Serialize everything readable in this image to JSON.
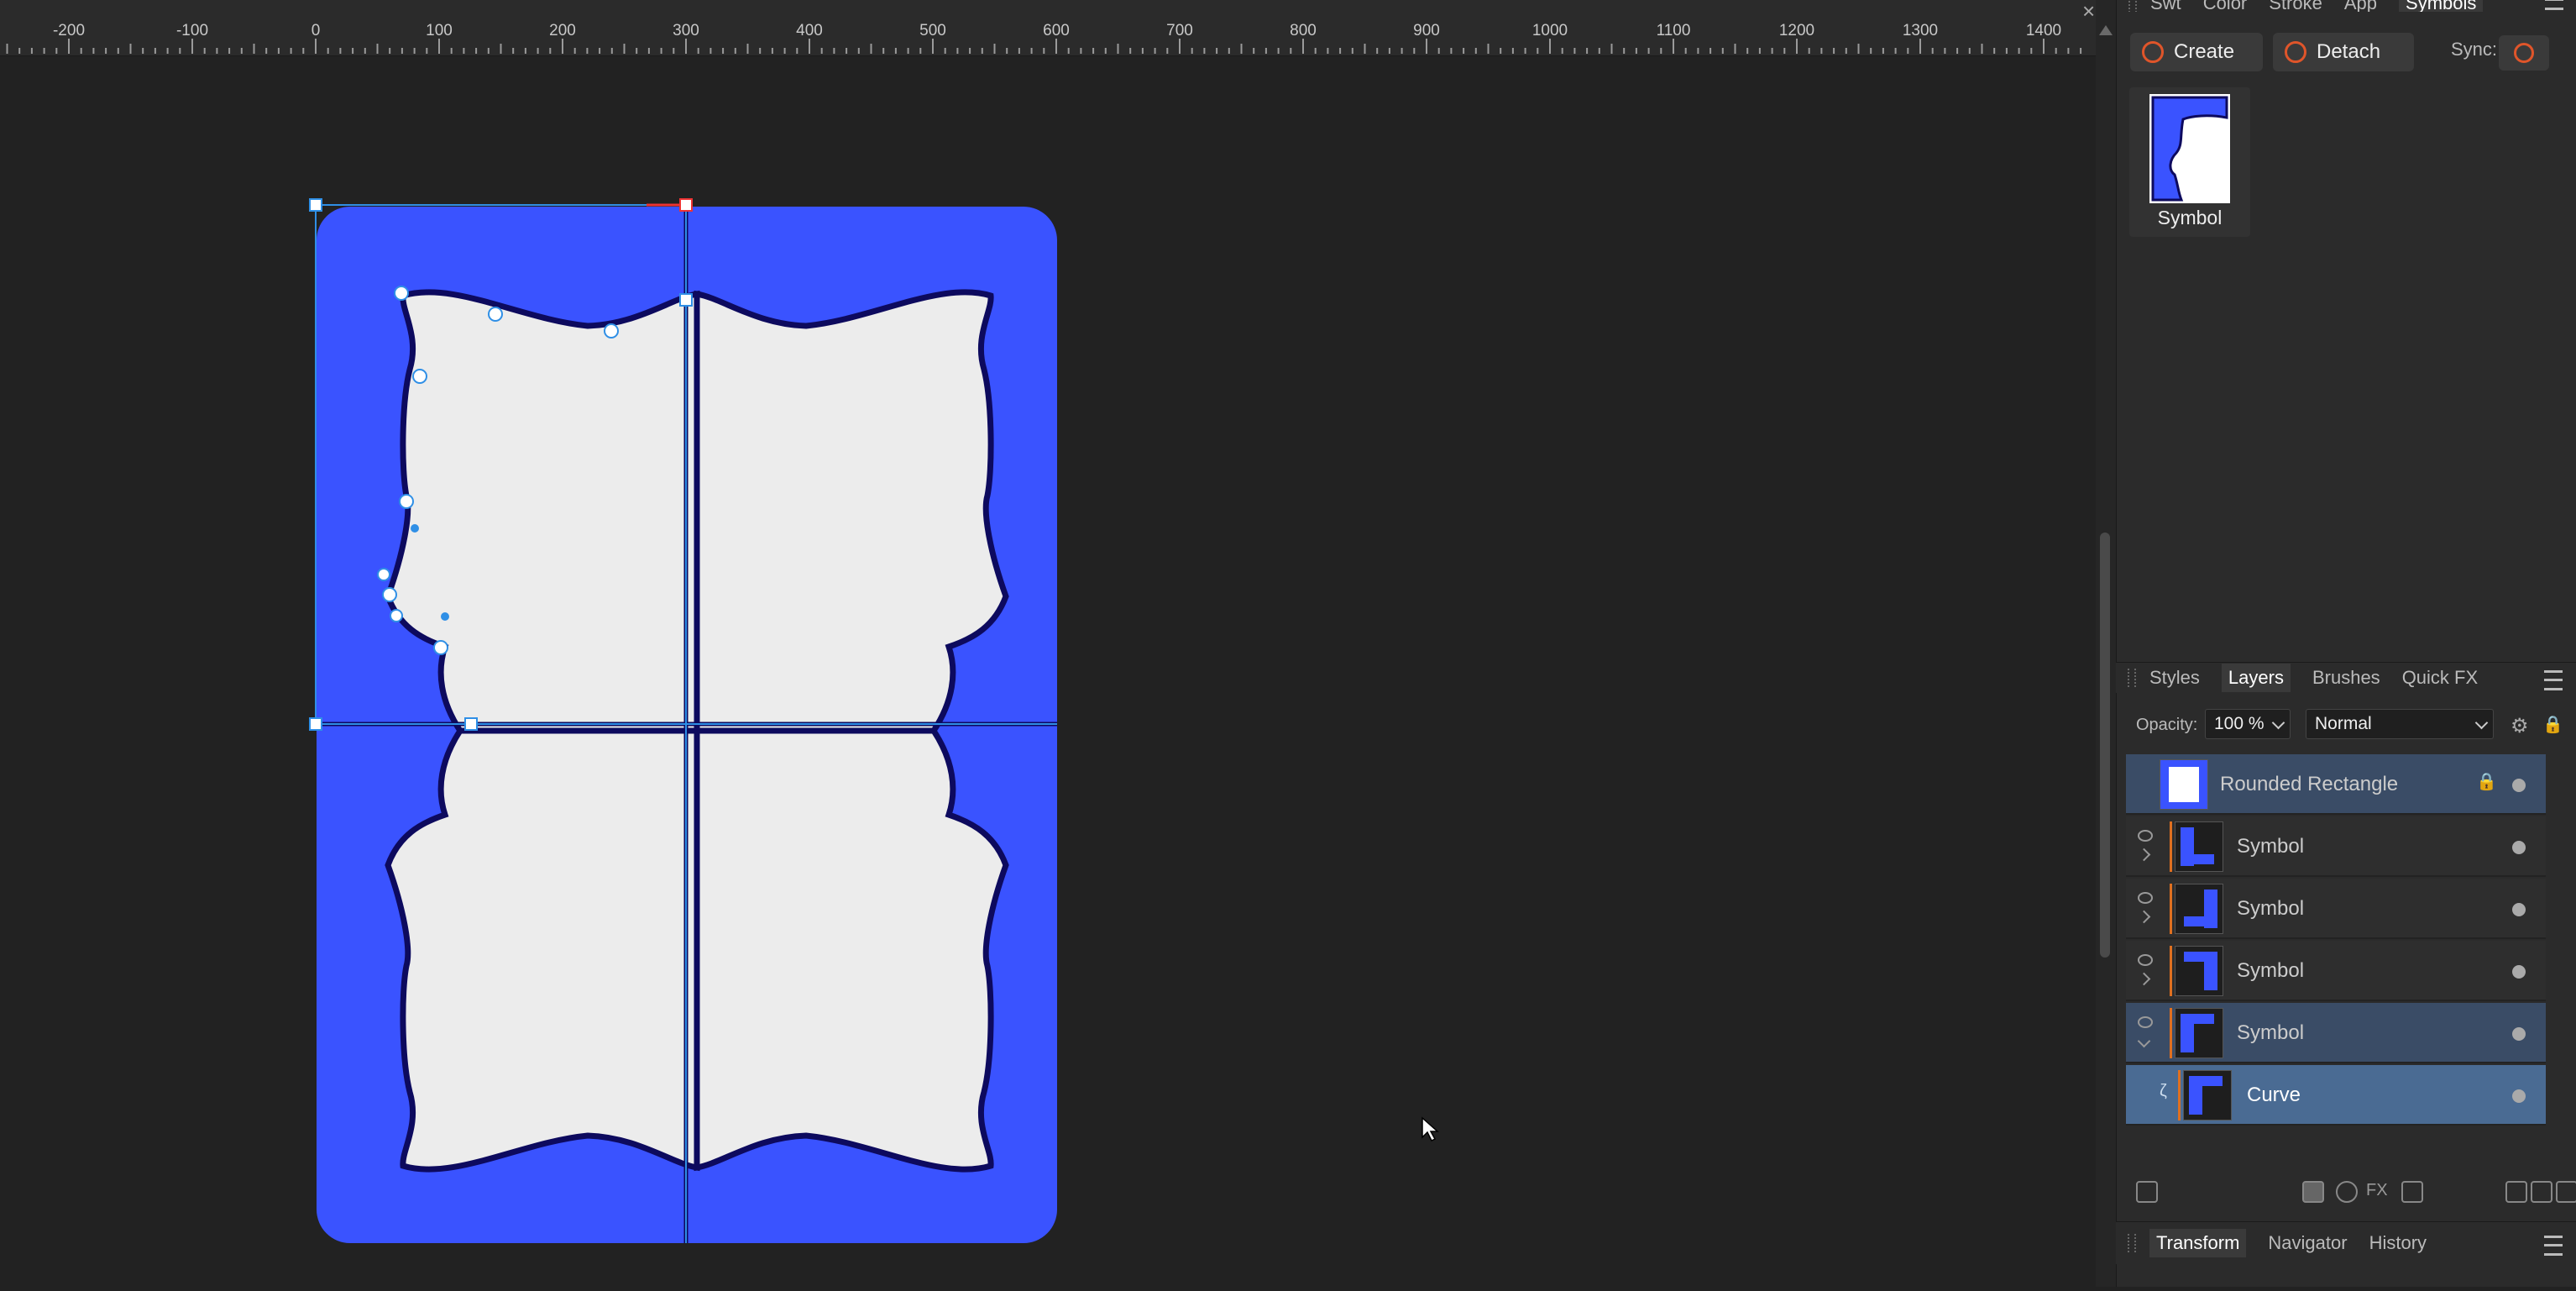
{
  "ruler": {
    "labels": [
      "-200",
      "-100",
      "0",
      "100",
      "200",
      "300",
      "400",
      "500",
      "600",
      "700",
      "800",
      "900",
      "1000",
      "1100",
      "1200",
      "1300",
      "1400"
    ]
  },
  "colors": {
    "fill_blue": "#3a53ff",
    "frame_light": "#ececec",
    "outline_dark": "#0d0a5e",
    "selection": "#2f8fe6",
    "accent_orange": "#e0552a"
  },
  "panel": {
    "top_tabs": [
      "Swt",
      "Color",
      "Stroke",
      "App",
      "Symbols"
    ],
    "active_top_tab": "Symbols",
    "create_label": "Create",
    "detach_label": "Detach",
    "sync_label": "Sync:",
    "symbol_card_label": "Symbol"
  },
  "layers_panel": {
    "tabs": [
      "Styles",
      "Layers",
      "Brushes",
      "Quick FX"
    ],
    "active_tab": "Layers",
    "opacity_label": "Opacity:",
    "opacity_value": "100 %",
    "blend_mode": "Normal",
    "layers": [
      {
        "name": "Rounded Rectangle"
      },
      {
        "name": "Symbol"
      },
      {
        "name": "Symbol"
      },
      {
        "name": "Symbol"
      },
      {
        "name": "Symbol"
      },
      {
        "name": "Curve"
      }
    ]
  },
  "bottom_tabs": [
    "Transform",
    "Navigator",
    "History"
  ],
  "active_bottom_tab": "Transform"
}
